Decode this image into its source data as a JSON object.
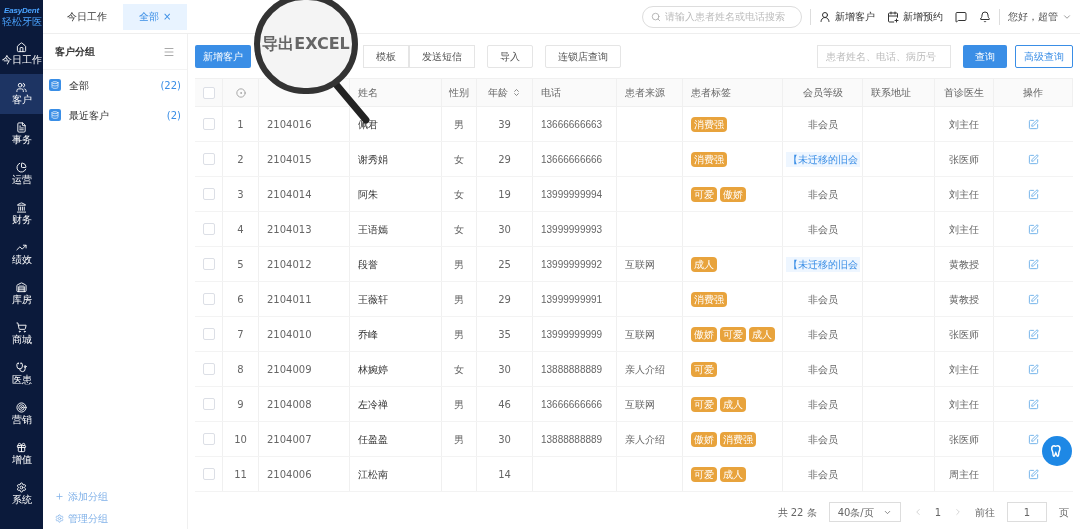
{
  "logo": {
    "brand": "EasyDent",
    "subtitle": "轻松牙医"
  },
  "nav": [
    {
      "label": "今日工作",
      "selected": false
    },
    {
      "label": "客户",
      "selected": true
    },
    {
      "label": "事务",
      "selected": false
    },
    {
      "label": "运营",
      "selected": false
    },
    {
      "label": "财务",
      "selected": false
    },
    {
      "label": "绩效",
      "selected": false
    },
    {
      "label": "库房",
      "selected": false
    },
    {
      "label": "商城",
      "selected": false
    },
    {
      "label": "医患",
      "selected": false
    },
    {
      "label": "营销",
      "selected": false
    },
    {
      "label": "增值",
      "selected": false
    },
    {
      "label": "系统",
      "selected": false
    }
  ],
  "tabs": [
    {
      "label": "今日工作",
      "selected": false,
      "closable": false
    },
    {
      "label": "全部",
      "selected": true,
      "closable": true,
      "close": "×"
    }
  ],
  "topbar": {
    "search": {
      "placeholder": "请输入患者姓名或电话搜索"
    },
    "actions": [
      "新增客户",
      "新增预约"
    ],
    "user": "您好，超管"
  },
  "groups": {
    "title": "客户分组",
    "items": [
      {
        "label": "全部",
        "count": "(22)",
        "selected": false
      },
      {
        "label": "最近客户",
        "count": "(2)",
        "selected": false
      }
    ],
    "footer": [
      "添加分组",
      "管理分组"
    ]
  },
  "toolbar": {
    "primary": "新增客户",
    "buttons": [
      "模板",
      "发送短信"
    ],
    "import": "导入",
    "chain": "连锁店查询",
    "search": {
      "placeholder": "患者姓名、电话、病历号"
    },
    "query": "查询",
    "advanced": "高级查询"
  },
  "magnifier": {
    "text": "导出EXCEL"
  },
  "table": {
    "header_checked": false,
    "columns": [
      "姓名",
      "性别",
      "年龄",
      "电话",
      "患者来源",
      "患者标签",
      "会员等级",
      "联系地址",
      "首诊医生",
      "操作"
    ],
    "rows": [
      {
        "checked": false,
        "index": "1",
        "id": "2104016",
        "name": "佩君",
        "gender": "男",
        "age": "39",
        "phone": "13666666663",
        "source": "",
        "tags": [
          "消费强"
        ],
        "member": {
          "kind": "plain",
          "text": "非会员"
        },
        "doctor": "刘主任"
      },
      {
        "checked": false,
        "index": "2",
        "id": "2104015",
        "name": "谢秀娟",
        "gender": "女",
        "age": "29",
        "phone": "13666666666",
        "source": "",
        "tags": [
          "消费强"
        ],
        "member": {
          "kind": "migrated",
          "text": "【未迁移的旧会"
        },
        "doctor": "张医师"
      },
      {
        "checked": false,
        "index": "3",
        "id": "2104014",
        "name": "阿朱",
        "gender": "女",
        "age": "19",
        "phone": "13999999994",
        "source": "",
        "tags": [
          "可爱",
          "傲娇"
        ],
        "member": {
          "kind": "plain",
          "text": "非会员"
        },
        "doctor": "刘主任"
      },
      {
        "checked": false,
        "index": "4",
        "id": "2104013",
        "name": "王语嫣",
        "gender": "女",
        "age": "30",
        "phone": "13999999993",
        "source": "",
        "tags": [],
        "member": {
          "kind": "plain",
          "text": "非会员"
        },
        "doctor": "刘主任"
      },
      {
        "checked": false,
        "index": "5",
        "id": "2104012",
        "name": "段誉",
        "gender": "男",
        "age": "25",
        "phone": "13999999992",
        "source": "互联网",
        "tags": [
          "成人"
        ],
        "member": {
          "kind": "migrated",
          "text": "【未迁移的旧会"
        },
        "doctor": "黄教授"
      },
      {
        "checked": false,
        "index": "6",
        "id": "2104011",
        "name": "王薇轩",
        "gender": "男",
        "age": "29",
        "phone": "13999999991",
        "source": "",
        "tags": [
          "消费强"
        ],
        "member": {
          "kind": "plain",
          "text": "非会员"
        },
        "doctor": "黄教授"
      },
      {
        "checked": false,
        "index": "7",
        "id": "2104010",
        "name": "乔峰",
        "gender": "男",
        "age": "35",
        "phone": "13999999999",
        "source": "互联网",
        "tags": [
          "傲娇",
          "可爱",
          "成人"
        ],
        "member": {
          "kind": "plain",
          "text": "非会员"
        },
        "doctor": "张医师"
      },
      {
        "checked": false,
        "index": "8",
        "id": "2104009",
        "name": "林婉婷",
        "gender": "女",
        "age": "30",
        "phone": "13888888889",
        "source": "亲人介绍",
        "tags": [
          "可爱"
        ],
        "member": {
          "kind": "plain",
          "text": "非会员"
        },
        "doctor": "刘主任"
      },
      {
        "checked": false,
        "index": "9",
        "id": "2104008",
        "name": "左冷禅",
        "gender": "男",
        "age": "46",
        "phone": "13666666666",
        "source": "互联网",
        "tags": [
          "可爱",
          "成人"
        ],
        "member": {
          "kind": "plain",
          "text": "非会员"
        },
        "doctor": "刘主任"
      },
      {
        "checked": false,
        "index": "10",
        "id": "2104007",
        "name": "任盈盈",
        "gender": "男",
        "age": "30",
        "phone": "13888888889",
        "source": "亲人介绍",
        "tags": [
          "傲娇",
          "消费强"
        ],
        "member": {
          "kind": "plain",
          "text": "非会员"
        },
        "doctor": "张医师"
      },
      {
        "checked": false,
        "index": "11",
        "id": "2104006",
        "name": "江松南",
        "gender": "",
        "age": "14",
        "phone": "",
        "source": "",
        "tags": [
          "可爱",
          "成人"
        ],
        "member": {
          "kind": "plain",
          "text": "非会员"
        },
        "doctor": "周主任"
      }
    ]
  },
  "pagination": {
    "total": "共 22 条",
    "page_size": "40条/页",
    "current": "1",
    "goto_label": "前往",
    "goto_value": "1",
    "page_unit": "页"
  }
}
